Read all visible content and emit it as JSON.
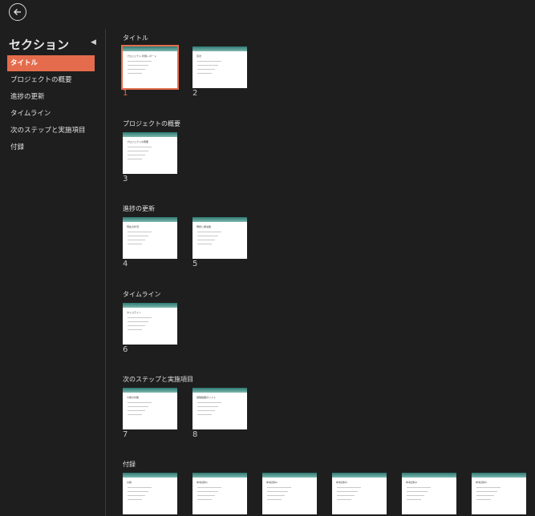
{
  "sidebar": {
    "title": "セクション",
    "items": [
      {
        "label": "タイトル",
        "active": true
      },
      {
        "label": "プロジェクトの概要",
        "active": false
      },
      {
        "label": "進捗の更新",
        "active": false
      },
      {
        "label": "タイムライン",
        "active": false
      },
      {
        "label": "次のステップと実施項目",
        "active": false
      },
      {
        "label": "付録",
        "active": false
      }
    ]
  },
  "sections": [
    {
      "title": "タイトル",
      "slides": [
        {
          "number": "1",
          "thumb_title": "プロジェクト 状態レポート",
          "selected": true
        },
        {
          "number": "2",
          "thumb_title": "目次"
        }
      ]
    },
    {
      "title": "プロジェクトの概要",
      "slides": [
        {
          "number": "3",
          "thumb_title": "プロジェクトの概要"
        }
      ]
    },
    {
      "title": "進捗の更新",
      "slides": [
        {
          "number": "4",
          "thumb_title": "現在の状況"
        },
        {
          "number": "5",
          "thumb_title": "問題と解決策"
        }
      ]
    },
    {
      "title": "タイムライン",
      "slides": [
        {
          "number": "6",
          "thumb_title": "タイムライン"
        }
      ]
    },
    {
      "title": "次のステップと実施項目",
      "slides": [
        {
          "number": "7",
          "thumb_title": "今後の対策"
        },
        {
          "number": "8",
          "thumb_title": "施策範囲のリスト"
        }
      ]
    },
    {
      "title": "付録",
      "slides": [
        {
          "thumb_title": "付録"
        },
        {
          "thumb_title": "参考資料1"
        },
        {
          "thumb_title": "参考資料2"
        },
        {
          "thumb_title": "参考資料3"
        },
        {
          "thumb_title": "参考資料4"
        },
        {
          "thumb_title": "参考資料5"
        }
      ]
    }
  ],
  "colors": {
    "accent": "#e46c4c",
    "background": "#1e1e1e",
    "banner": "#2d7a72"
  },
  "icons": {
    "back": "back-arrow-icon",
    "collapse": "chevron-left-icon"
  }
}
